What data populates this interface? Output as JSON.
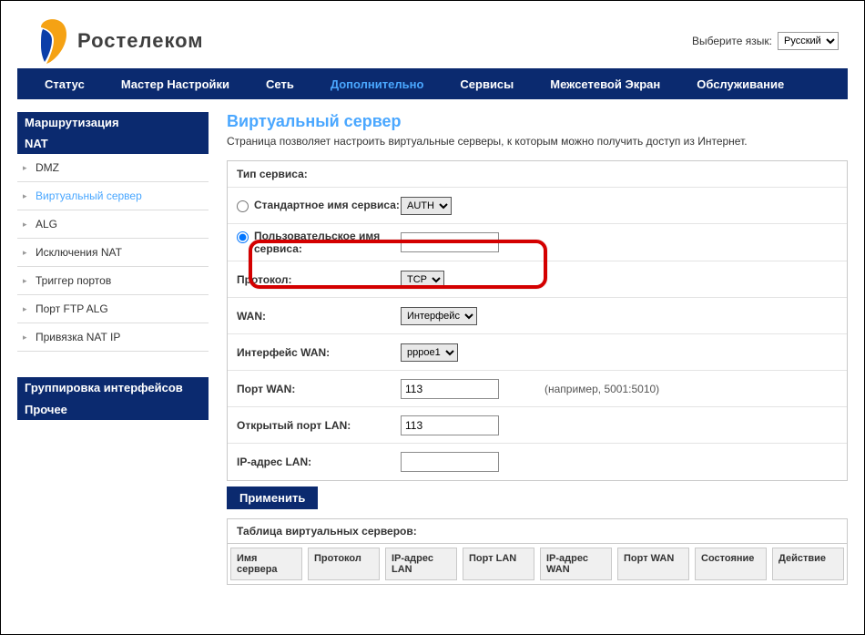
{
  "lang": {
    "label": "Выберите язык:",
    "value": "Русский"
  },
  "brand": "Ростелеком",
  "nav": {
    "status": "Статус",
    "wizard": "Мастер Настройки",
    "network": "Сеть",
    "advanced": "Дополнительно",
    "services": "Сервисы",
    "firewall": "Межсетевой Экран",
    "maintenance": "Обслуживание"
  },
  "sidebar": {
    "routing": "Маршрутизация",
    "nat": "NAT",
    "nat_items": {
      "dmz": "DMZ",
      "vserver": "Виртуальный сервер",
      "alg": "ALG",
      "nat_excl": "Исключения NAT",
      "port_trigger": "Триггер портов",
      "ftp_alg": "Порт FTP ALG",
      "nat_ip_bind": "Привязка NAT IP"
    },
    "if_group": "Группировка интерфейсов",
    "other": "Прочее"
  },
  "page": {
    "title": "Виртуальный сервер",
    "desc": "Страница позволяет настроить виртуальные серверы, к которым можно получить доступ из Интернет."
  },
  "form": {
    "service_type_head": "Тип сервиса:",
    "std_name_label": "Стандартное имя сервиса:",
    "std_name_value": "AUTH",
    "user_name_label": "Пользовательское имя сервиса:",
    "user_name_value": "",
    "protocol_label": "Протокол:",
    "protocol_value": "TCP",
    "wan_mode_label": "WAN:",
    "wan_mode_value": "Интерфейс",
    "wan_if_label": "Интерфейс WAN:",
    "wan_if_value": "pppoe1",
    "wan_port_label": "Порт WAN:",
    "wan_port_value": "113",
    "wan_port_hint": "(например, 5001:5010)",
    "lan_port_label": "Открытый порт LAN:",
    "lan_port_value": "113",
    "lan_ip_label": "IP-адрес LAN:",
    "lan_ip_value": "",
    "apply": "Применить"
  },
  "vs_table": {
    "title": "Таблица виртуальных серверов:",
    "cols": {
      "name": "Имя сервера",
      "proto": "Протокол",
      "lan_ip": "IP-адрес LAN",
      "lan_port": "Порт LAN",
      "wan_ip": "IP-адрес WAN",
      "wan_port": "Порт WAN",
      "state": "Состояние",
      "action": "Действие"
    }
  }
}
